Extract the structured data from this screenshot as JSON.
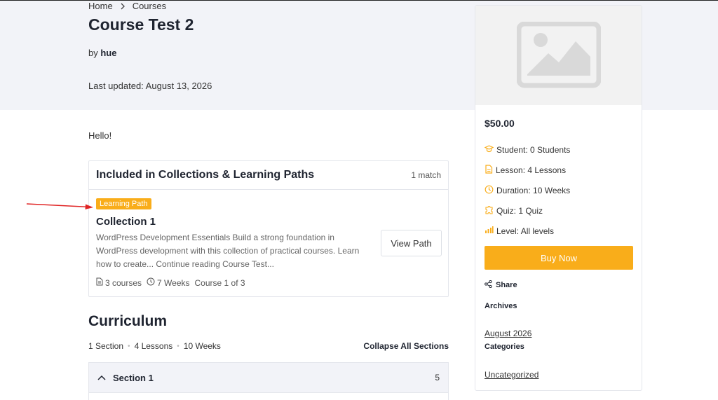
{
  "breadcrumb": {
    "home": "Home",
    "current": "Courses"
  },
  "course": {
    "title": "Course Test 2",
    "by_label": "by",
    "author": "hue",
    "last_updated": "Last updated: August 13, 2026",
    "intro": "Hello!"
  },
  "collections": {
    "heading": "Included in Collections & Learning Paths",
    "match_count": "1 match",
    "badge": "Learning Path",
    "title": "Collection 1",
    "description": "WordPress Development Essentials Build a strong foundation in WordPress development with this collection of practical courses. Learn how to create... Continue reading Course Test...",
    "view_button": "View Path",
    "meta": {
      "courses": "3 courses",
      "duration": "7 Weeks",
      "position": "Course 1 of 3"
    }
  },
  "curriculum": {
    "title": "Curriculum",
    "sections": "1 Section",
    "lessons": "4 Lessons",
    "duration": "10 Weeks",
    "collapse_label": "Collapse All Sections",
    "section_items": [
      {
        "name": "Section 1",
        "count": "5"
      }
    ]
  },
  "sidebar": {
    "price": "$50.00",
    "student": "Student: 0 Students",
    "lesson": "Lesson: 4 Lessons",
    "duration": "Duration: 10 Weeks",
    "quiz": "Quiz: 1 Quiz",
    "level": "Level: All levels",
    "buy_label": "Buy Now",
    "share_label": "Share",
    "archives_heading": "Archives",
    "archive_link": "August 2026",
    "categories_heading": "Categories",
    "category_link": "Uncategorized"
  },
  "colors": {
    "accent": "#f9ad1a",
    "hero_bg": "#f2f3f8",
    "arrow": "#e02424"
  },
  "icons": [
    "chevron-right-icon",
    "image-placeholder-icon",
    "graduation-cap-icon",
    "document-icon",
    "clock-icon",
    "puzzle-icon",
    "bar-chart-icon",
    "share-icon",
    "chevron-up-icon",
    "red-arrow-annotation"
  ]
}
